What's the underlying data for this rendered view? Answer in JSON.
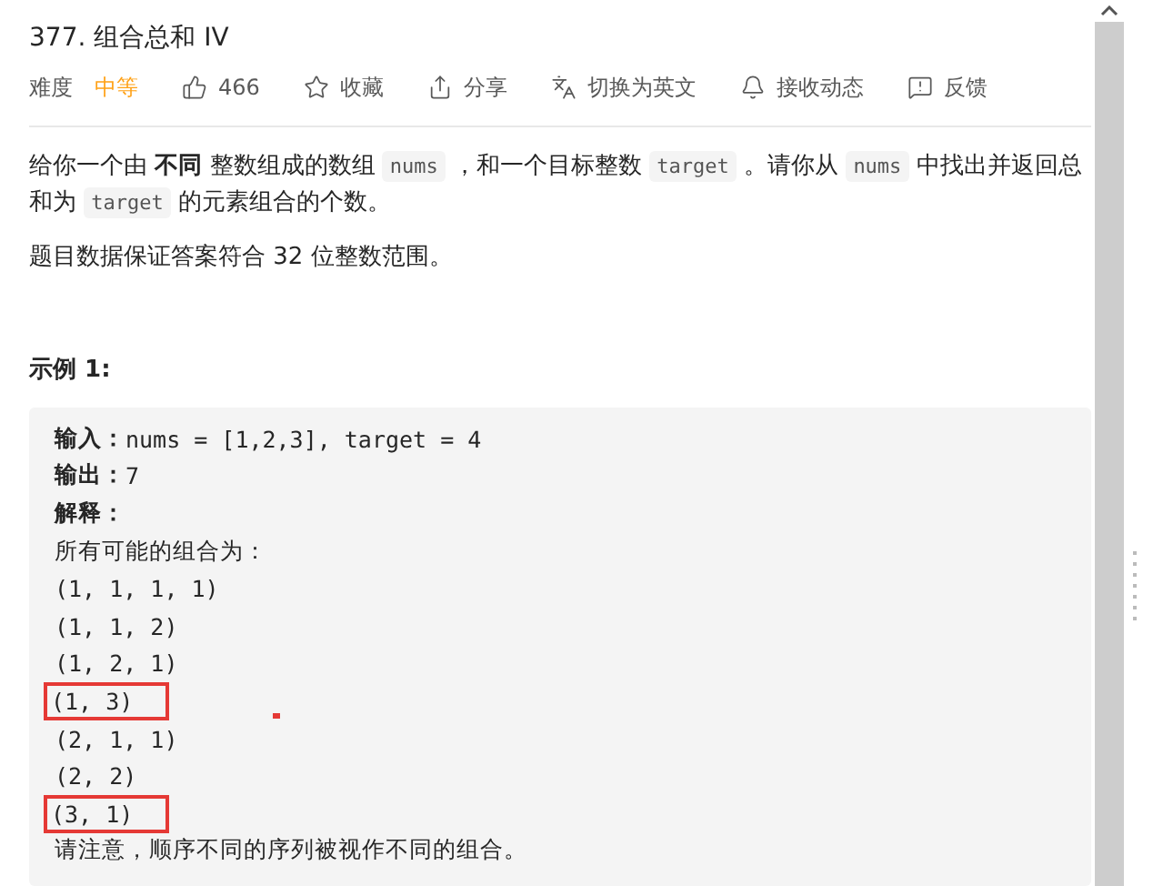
{
  "title": "377. 组合总和 IV",
  "meta": [
    {
      "kind": "label",
      "text": "难度"
    },
    {
      "kind": "difficulty",
      "text": "中等"
    },
    {
      "kind": "like",
      "text": "466"
    },
    {
      "kind": "star",
      "text": "收藏"
    },
    {
      "kind": "share",
      "text": "分享"
    },
    {
      "kind": "translate",
      "text": "切换为英文"
    },
    {
      "kind": "bell",
      "text": "接收动态"
    },
    {
      "kind": "feedback",
      "text": "反馈"
    }
  ],
  "description": [
    [
      {
        "kind": "text",
        "text": "给你一个由 "
      },
      {
        "kind": "bold",
        "text": "不同"
      },
      {
        "kind": "text",
        "text": " 整数组成的数组 "
      },
      {
        "kind": "code",
        "text": "nums"
      },
      {
        "kind": "text",
        "text": " ，和一个目标整数 "
      },
      {
        "kind": "code",
        "text": "target"
      },
      {
        "kind": "text",
        "text": " 。请你从 "
      },
      {
        "kind": "code",
        "text": "nums"
      },
      {
        "kind": "text",
        "text": " 中找出并返回总和为 "
      },
      {
        "kind": "code",
        "text": "target"
      },
      {
        "kind": "text",
        "text": " 的元素组合的个数。"
      }
    ],
    [
      {
        "kind": "text",
        "text": "题目数据保证答案符合 32 位整数范围。"
      }
    ]
  ],
  "example_heading": "示例 1:",
  "example": {
    "input_label": "输入：",
    "input": "nums = [1,2,3], target = 4",
    "output_label": "输出：",
    "output": "7",
    "explain_label": "解释：",
    "lines": [
      {
        "text": "所有可能的组合为：",
        "highlighted": false
      },
      {
        "text": "(1, 1, 1, 1)",
        "highlighted": false
      },
      {
        "text": "(1, 1, 2)",
        "highlighted": false
      },
      {
        "text": "(1, 2, 1)",
        "highlighted": false
      },
      {
        "text": "(1, 3)",
        "highlighted": true
      },
      {
        "text": "(2, 1, 1)",
        "highlighted": false
      },
      {
        "text": "(2, 2)",
        "highlighted": false
      },
      {
        "text": "(3, 1)",
        "highlighted": true
      },
      {
        "text": "请注意，顺序不同的序列被视作不同的组合。",
        "highlighted": false
      }
    ]
  }
}
